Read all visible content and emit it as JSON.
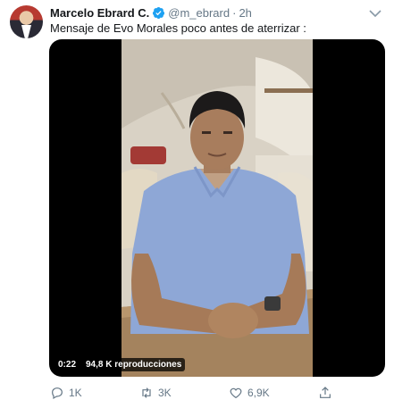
{
  "tweet": {
    "author_name": "Marcelo Ebrard C.",
    "handle": "@m_ebrard",
    "separator": "·",
    "time": "2h",
    "text": "Mensaje de Evo Morales poco antes de aterrizar :"
  },
  "video": {
    "duration": "0:22",
    "views": "94,8 K reproducciones"
  },
  "actions": {
    "replies": "1K",
    "retweets": "3K",
    "likes": "6,9K"
  },
  "colors": {
    "verified_badge": "#1da1f2",
    "muted_text": "#657786"
  },
  "icons": [
    "verified-icon",
    "chevron-down-icon",
    "reply-icon",
    "retweet-icon",
    "like-icon",
    "share-icon"
  ]
}
